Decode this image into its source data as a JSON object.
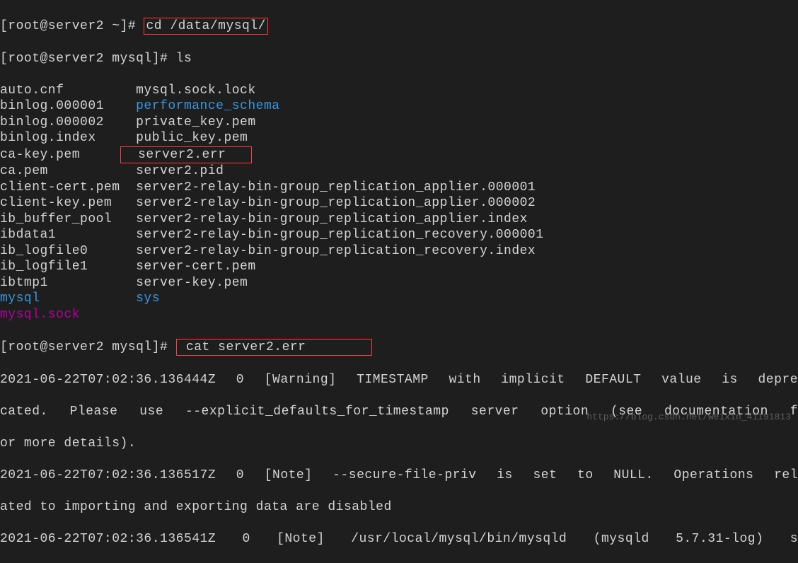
{
  "prompt1": {
    "prefix": "[root@server2 ~]# ",
    "cmd": "cd /data/mysql/"
  },
  "prompt2": {
    "prefix": "[root@server2 mysql]# ",
    "cmd": "ls"
  },
  "ls": {
    "rows": [
      {
        "c1": "auto.cnf       ",
        "c2": "  mysql.sock.lock",
        "c2_class": ""
      },
      {
        "c1": "binlog.000001  ",
        "c2": "  performance_schema",
        "c2_class": "blue"
      },
      {
        "c1": "binlog.000002  ",
        "c2": "  private_key.pem",
        "c2_class": ""
      },
      {
        "c1": "binlog.index   ",
        "c2": "  public_key.pem",
        "c2_class": ""
      },
      {
        "c1": "ca-key.pem     ",
        "c2": "  server2.err   ",
        "c2_class": "",
        "box": true
      },
      {
        "c1": "ca.pem         ",
        "c2": "  server2.pid",
        "c2_class": ""
      },
      {
        "c1": "client-cert.pem",
        "c2": "  server2-relay-bin-group_replication_applier.000001",
        "c2_class": ""
      },
      {
        "c1": "client-key.pem ",
        "c2": "  server2-relay-bin-group_replication_applier.000002",
        "c2_class": ""
      },
      {
        "c1": "ib_buffer_pool ",
        "c2": "  server2-relay-bin-group_replication_applier.index",
        "c2_class": ""
      },
      {
        "c1": "ibdata1        ",
        "c2": "  server2-relay-bin-group_replication_recovery.000001",
        "c2_class": ""
      },
      {
        "c1": "ib_logfile0    ",
        "c2": "  server2-relay-bin-group_replication_recovery.index",
        "c2_class": ""
      },
      {
        "c1": "ib_logfile1    ",
        "c2": "  server-cert.pem",
        "c2_class": ""
      },
      {
        "c1": "ibtmp1         ",
        "c2": "  server-key.pem",
        "c2_class": ""
      },
      {
        "c1": "mysql          ",
        "c1_class": "blue",
        "c2": "  sys",
        "c2_class": "blue"
      },
      {
        "c1": "mysql.sock",
        "c1_class": "magenta",
        "c2": "",
        "c2_class": ""
      }
    ]
  },
  "prompt3": {
    "prefix": "[root@server2 mysql]# ",
    "cmd": " cat server2.err        "
  },
  "log": {
    "line1": "2021-06-22T07:02:36.136444Z 0 [Warning] TIMESTAMP with implicit DEFAULT value is depre",
    "line2": "cated. Please use --explicit_defaults_for_timestamp server option (see documentation f",
    "line3": "or more details).",
    "line4": "2021-06-22T07:02:36.136517Z 0 [Note] --secure-file-priv is set to NULL. Operations rel",
    "line5": "ated to importing and exporting data are disabled",
    "line6": "2021-06-22T07:02:36.136541Z 0 [Note] /usr/local/mysql/bin/mysqld (mysqld 5.7.31-log) s"
  },
  "watermark": "https://blog.csdn.net/weixin_41191813"
}
